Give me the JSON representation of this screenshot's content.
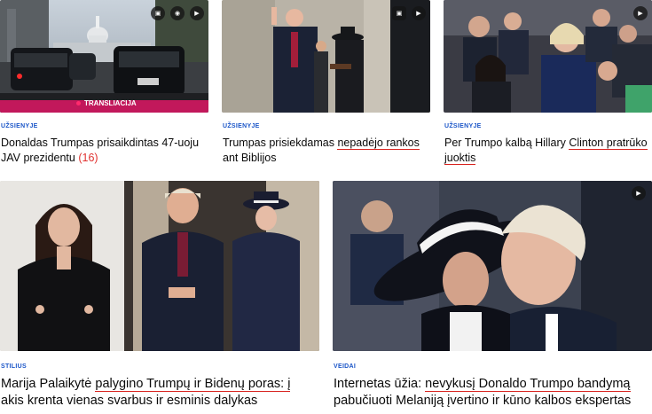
{
  "articles": [
    {
      "category": "UŽSIENYJE",
      "title_plain": "Donaldas Trumpas prisaikdintas 47-uoju JAV prezidentu",
      "comment_count": "(16)",
      "live_label": "TRANSLIACIJA"
    },
    {
      "category": "UŽSIENYJE",
      "title_a": "Trumpas prisiekdamas ",
      "title_u": "nepadėjo rankos",
      "title_b": " ant Biblijos"
    },
    {
      "category": "UŽSIENYJE",
      "title_a": "Per Trumpo kalbą Hillary ",
      "title_u1": "Clinton pratrūko",
      "title_b": " ",
      "title_u2": "juoktis"
    },
    {
      "category": "STILIUS",
      "title_a": "Marija Palaikytė ",
      "title_u": "palygino Trumpų ir Bidenų poras: į",
      "title_b": " akis krenta vienas svarbus ir esminis dalykas"
    },
    {
      "category": "VEIDAI",
      "title_a": "Internetas ūžia: ",
      "title_u": "nevykusį Donaldo Trumpo bandymą",
      "title_b": " pabučiuoti Melaniją įvertino ir kūno kalbos ekspertas"
    }
  ],
  "icons": {
    "gallery": "gallery-icon",
    "live": "broadcast-icon",
    "play": "play-icon"
  },
  "colors": {
    "category": "#1a55c8",
    "underline": "#d8231f",
    "count": "#e0312f",
    "live_bar": "#d81b60"
  }
}
